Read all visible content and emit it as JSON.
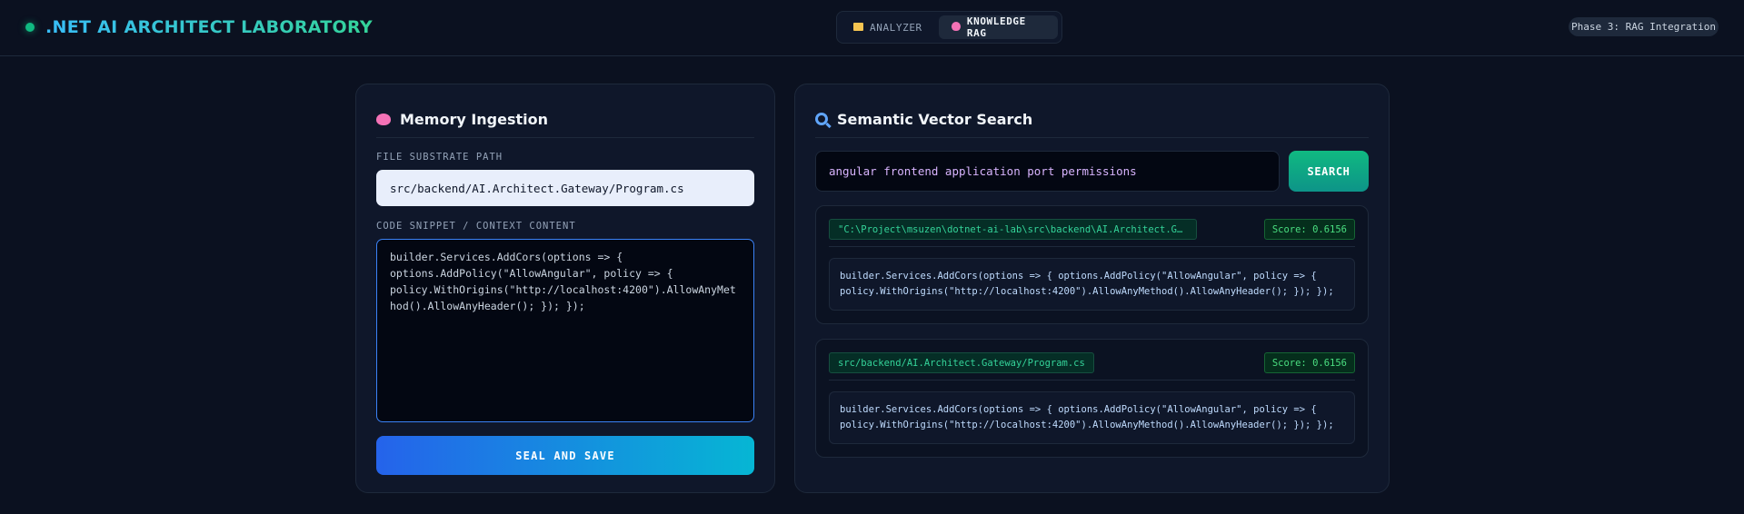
{
  "header": {
    "title": ".NET AI ARCHITECT LABORATORY",
    "status_dot_color": "#10b981",
    "tabs": [
      {
        "label": "ANALYZER",
        "icon": "folder-icon",
        "active": false
      },
      {
        "label": "KNOWLEDGE RAG",
        "icon": "brain-icon",
        "active": true
      }
    ],
    "phase_badge": "Phase 3: RAG Integration"
  },
  "ingestion": {
    "title": "Memory Ingestion",
    "icon": "brain-icon",
    "path_label": "FILE SUBSTRATE PATH",
    "path_value": "src/backend/AI.Architect.Gateway/Program.cs",
    "code_label": "CODE SNIPPET / CONTEXT CONTENT",
    "code_value": "builder.Services.AddCors(options => {\noptions.AddPolicy(\"AllowAngular\", policy => {\npolicy.WithOrigins(\"http://localhost:4200\").AllowAnyMethod().AllowAnyHeader(); }); });",
    "button_label": "SEAL AND SAVE"
  },
  "search": {
    "title": "Semantic Vector Search",
    "icon": "magnifier-icon",
    "query_value": "angular frontend application port permissions",
    "button_label": "SEARCH",
    "results": [
      {
        "source": "\"C:\\Project\\msuzen\\dotnet-ai-lab\\src\\backend\\AI.Architect.Gatew…",
        "score": "Score: 0.6156",
        "snippet": "builder.Services.AddCors(options => { options.AddPolicy(\"AllowAngular\", policy => { policy.WithOrigins(\"http://localhost:4200\").AllowAnyMethod().AllowAnyHeader(); }); });"
      },
      {
        "source": "src/backend/AI.Architect.Gateway/Program.cs",
        "score": "Score: 0.6156",
        "snippet": "builder.Services.AddCors(options => { options.AddPolicy(\"AllowAngular\", policy => { policy.WithOrigins(\"http://localhost:4200\").AllowAnyMethod().AllowAnyHeader(); }); });"
      }
    ]
  },
  "colors": {
    "background": "#0b1120",
    "panel": "#0f172a",
    "accent_blue": "#2563eb",
    "accent_cyan": "#06b6d4",
    "accent_green": "#10b981",
    "query_text": "#d8b4fe"
  }
}
